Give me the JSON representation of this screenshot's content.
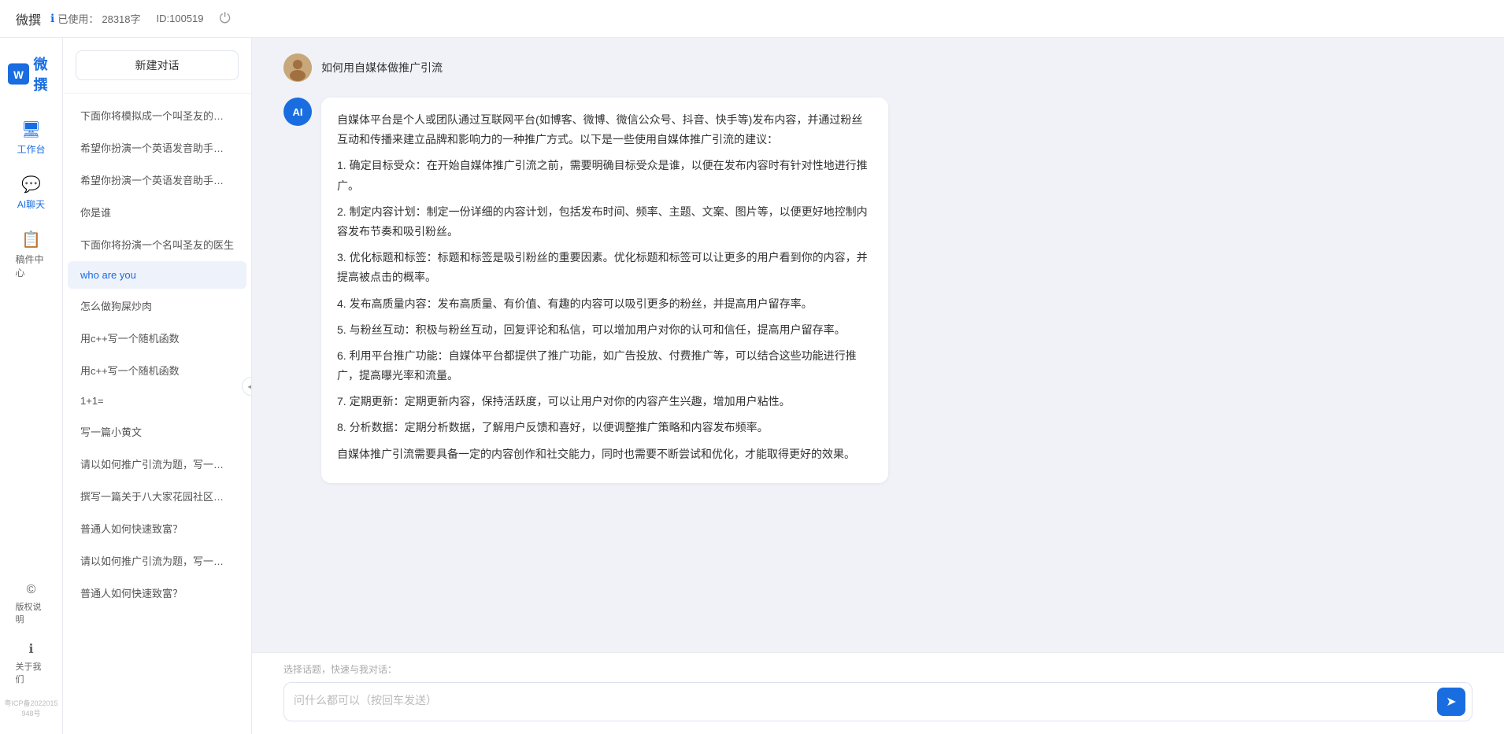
{
  "topbar": {
    "title": "微撰",
    "usage_label": "已使用：",
    "usage_count": "28318字",
    "id_label": "ID:100519",
    "power_icon": "⏻"
  },
  "logo": {
    "text": "微撰",
    "icon_letter": "W"
  },
  "nav": {
    "items": [
      {
        "id": "workbench",
        "label": "工作台",
        "icon": "🖥"
      },
      {
        "id": "ai-chat",
        "label": "AI聊天",
        "icon": "💬"
      },
      {
        "id": "mailbox",
        "label": "稿件中心",
        "icon": "📋"
      }
    ],
    "bottom_items": [
      {
        "id": "copyright",
        "label": "版权说明",
        "icon": "©"
      },
      {
        "id": "about",
        "label": "关于我们",
        "icon": "ℹ"
      }
    ],
    "icp": "粤ICP备2022015948号"
  },
  "sidebar": {
    "new_chat_label": "新建对话",
    "collapse_icon": "◀",
    "history": [
      "下面你将模拟成一个叫圣友的程序员，我说...",
      "希望你扮演一个英语发音助手，我提供给你...",
      "希望你扮演一个英语发音助手，我提供给你...",
      "你是谁",
      "下面你将扮演一个名叫圣友的医生",
      "who are you",
      "怎么做狗屎炒肉",
      "用c++写一个随机函数",
      "用c++写一个随机函数",
      "1+1=",
      "写一篇小黄文",
      "请以如何推广引流为题，写一篇大纲",
      "撰写一篇关于八大家花园社区一刻钟便民生...",
      "普通人如何快速致富？",
      "请以如何推广引流为题，写一篇大纲",
      "普通人如何快速致富？"
    ]
  },
  "chat": {
    "user_message": "如何用自媒体做推广引流",
    "ai_response": {
      "paragraphs": [
        "自媒体平台是个人或团队通过互联网平台(如博客、微博、微信公众号、抖音、快手等)发布内容，并通过粉丝互动和传播来建立品牌和影响力的一种推广方式。以下是一些使用自媒体推广引流的建议：",
        "1. 确定目标受众：在开始自媒体推广引流之前，需要明确目标受众是谁，以便在发布内容时有针对性地进行推广。",
        "2. 制定内容计划：制定一份详细的内容计划，包括发布时间、频率、主题、文案、图片等，以便更好地控制内容发布节奏和吸引粉丝。",
        "3. 优化标题和标签：标题和标签是吸引粉丝的重要因素。优化标题和标签可以让更多的用户看到你的内容，并提高被点击的概率。",
        "4. 发布高质量内容：发布高质量、有价值、有趣的内容可以吸引更多的粉丝，并提高用户留存率。",
        "5. 与粉丝互动：积极与粉丝互动，回复评论和私信，可以增加用户对你的认可和信任，提高用户留存率。",
        "6. 利用平台推广功能：自媒体平台都提供了推广功能，如广告投放、付费推广等，可以结合这些功能进行推广，提高曝光率和流量。",
        "7. 定期更新：定期更新内容，保持活跃度，可以让用户对你的内容产生兴趣，增加用户粘性。",
        "8. 分析数据：定期分析数据，了解用户反馈和喜好，以便调整推广策略和内容发布频率。",
        "自媒体推广引流需要具备一定的内容创作和社交能力，同时也需要不断尝试和优化，才能取得更好的效果。"
      ]
    }
  },
  "input": {
    "quick_select_label": "选择话题，快速与我对话：",
    "placeholder": "问什么都可以（按回车发送）",
    "send_icon": "➤"
  }
}
